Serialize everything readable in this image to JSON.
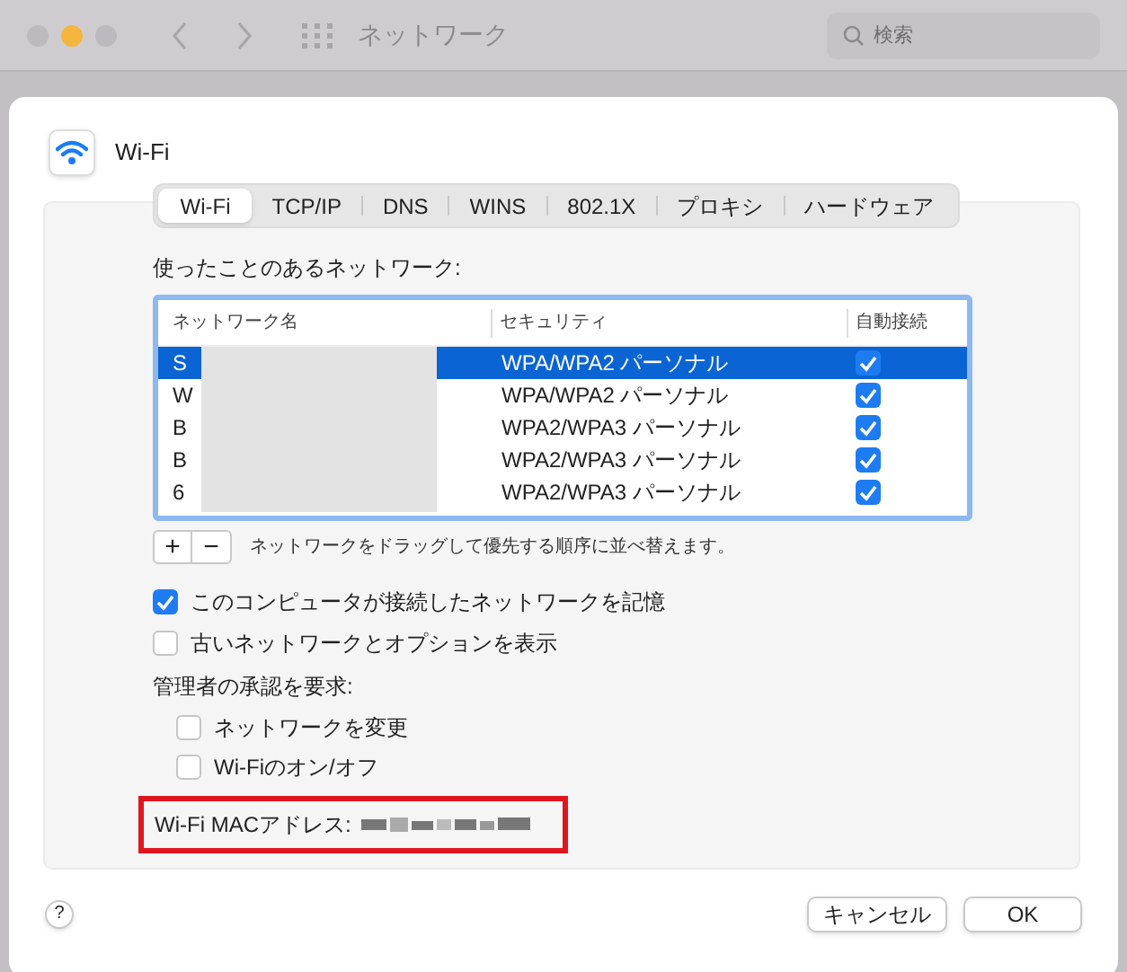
{
  "window": {
    "title": "ネットワーク",
    "search_placeholder": "検索"
  },
  "service": {
    "name": "Wi-Fi"
  },
  "tabs": [
    {
      "label": "Wi-Fi",
      "selected": true
    },
    {
      "label": "TCP/IP",
      "selected": false
    },
    {
      "label": "DNS",
      "selected": false
    },
    {
      "label": "WINS",
      "selected": false
    },
    {
      "label": "802.1X",
      "selected": false
    },
    {
      "label": "プロキシ",
      "selected": false
    },
    {
      "label": "ハードウェア",
      "selected": false
    }
  ],
  "networks_label": "使ったことのあるネットワーク:",
  "table": {
    "columns": [
      "ネットワーク名",
      "セキュリティ",
      "自動接続"
    ],
    "rows": [
      {
        "name": "S",
        "security": "WPA/WPA2 パーソナル",
        "auto_connect": true,
        "selected": true
      },
      {
        "name": "W",
        "security": "WPA/WPA2 パーソナル",
        "auto_connect": true,
        "selected": false
      },
      {
        "name": "B",
        "security": "WPA2/WPA3 パーソナル",
        "auto_connect": true,
        "selected": false
      },
      {
        "name": "B",
        "security": "WPA2/WPA3 パーソナル",
        "auto_connect": true,
        "selected": false
      },
      {
        "name": "6",
        "security": "WPA2/WPA3 パーソナル",
        "auto_connect": true,
        "selected": false
      }
    ]
  },
  "add_button": "+",
  "remove_button": "−",
  "hint": "ネットワークをドラッグして優先する順序に並べ替えます。",
  "options": [
    {
      "label": "このコンピュータが接続したネットワークを記憶",
      "checked": true
    },
    {
      "label": "古いネットワークとオプションを表示",
      "checked": false
    }
  ],
  "admin_label": "管理者の承認を要求:",
  "admin_options": [
    {
      "label": "ネットワークを変更",
      "checked": false
    },
    {
      "label": "Wi-Fiのオン/オフ",
      "checked": false
    }
  ],
  "mac_label": "Wi-Fi MACアドレス:",
  "help_button": "?",
  "buttons": [
    {
      "label": "キャンセル"
    },
    {
      "label": "OK"
    }
  ]
}
